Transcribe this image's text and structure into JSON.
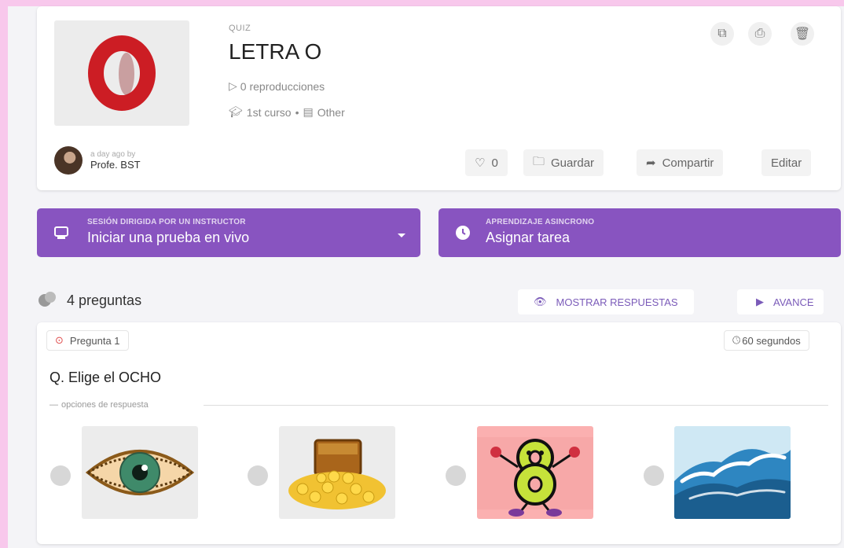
{
  "quiz": {
    "type_label": "QUIZ",
    "title": "LETRA O",
    "plays": "0 reproducciones",
    "grade": "1st curso",
    "separator": "•",
    "subject": "Other"
  },
  "author": {
    "time_by": "a day ago by",
    "name": "Profe. BST"
  },
  "actions": {
    "likes_count": "0",
    "save_label": "Guardar",
    "share_label": "Compartir",
    "edit_label": "Editar"
  },
  "live_session": {
    "caption": "SESIÓN DIRIGIDA POR UN INSTRUCTOR",
    "label": "Iniciar una prueba en vivo"
  },
  "assign": {
    "caption": "APRENDIZAJE ASINCRONO",
    "label": "Asignar tarea"
  },
  "questions_header": {
    "count_label": "4 preguntas",
    "show_answers_label": "MOSTRAR RESPUESTAS",
    "preview_label": "AVANCE"
  },
  "question": {
    "number_label": "Pregunta 1",
    "time_label": "60 segundos",
    "text": "Q. Elige el OCHO",
    "options_label": "opciones de respuesta",
    "options": [
      {
        "image": "eye-image"
      },
      {
        "image": "treasure-chest-image"
      },
      {
        "image": "number-eight-image"
      },
      {
        "image": "ocean-wave-image"
      }
    ]
  },
  "colors": {
    "purple": "#8854c0",
    "frame_pink": "#f8c8ec",
    "logo_red": "#cc1d24"
  }
}
